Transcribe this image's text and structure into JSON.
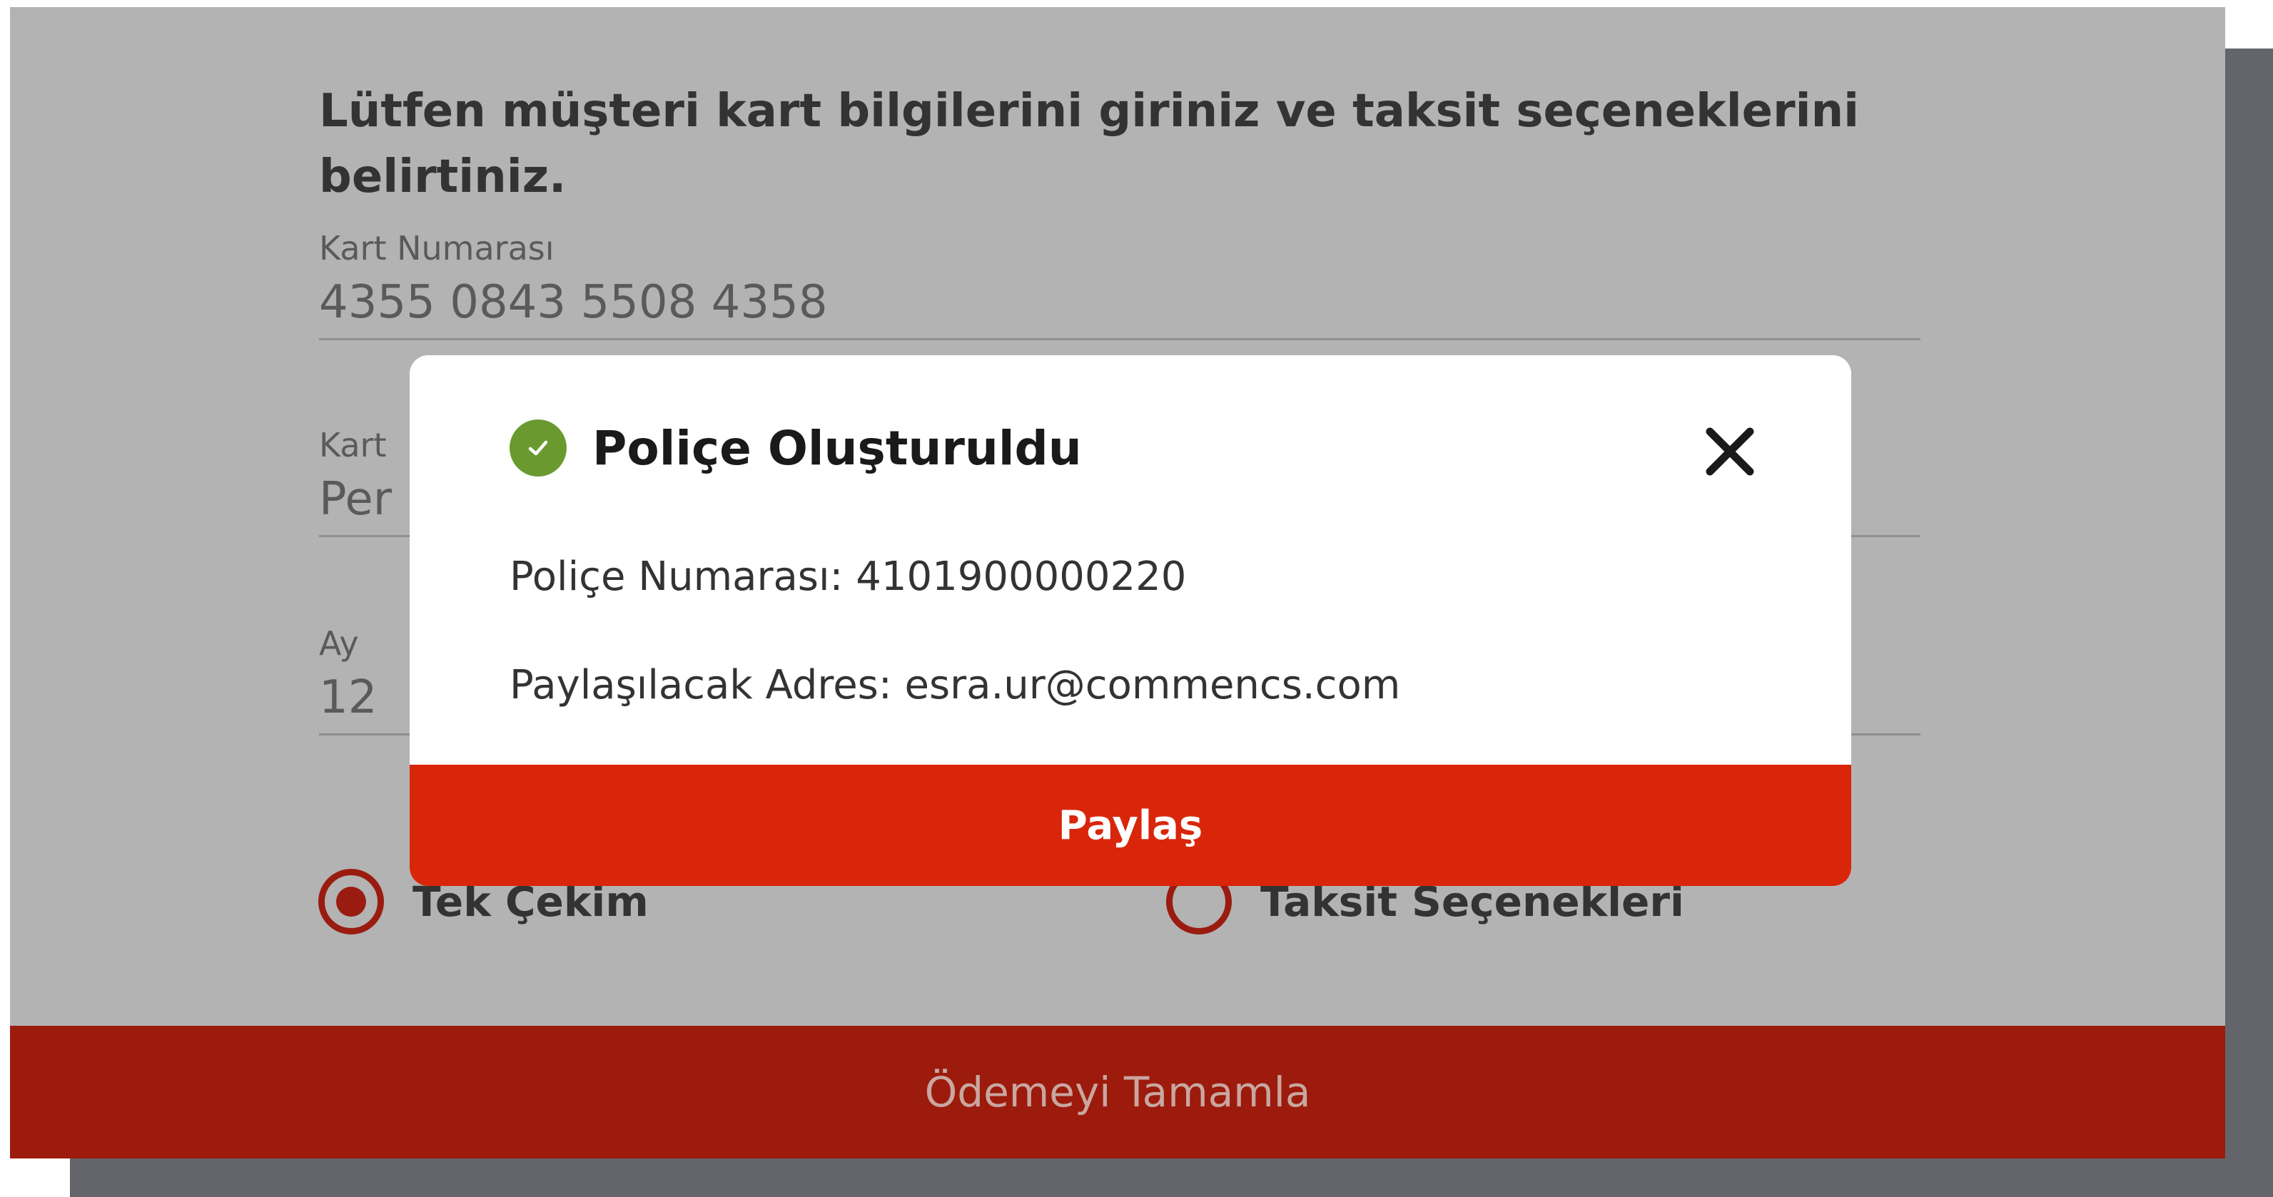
{
  "form": {
    "instruction": "Lütfen müşteri kart bilgilerini giriniz ve taksit seçeneklerini belirtiniz.",
    "card_number_label": "Kart Numarası",
    "card_number_value": "4355 0843 5508 4358",
    "card_holder_label": "Kart",
    "card_holder_value": "Per",
    "month_label": "Ay",
    "month_value": "12"
  },
  "payment_options": [
    {
      "label": "Tek Çekim",
      "selected": true
    },
    {
      "label": "Taksit Seçenekleri",
      "selected": false
    }
  ],
  "complete_button": {
    "label": "Ödemeyi Tamamla"
  },
  "modal": {
    "title": "Poliçe Oluşturuldu",
    "policy_label": "Poliçe Numarası:",
    "policy_number": "4101900000220",
    "address_label": "Paylaşılacak Adres:",
    "address": "esra.ur@commencs.com",
    "share_label": "Paylaş",
    "success_icon": "check-circle-icon",
    "close_icon": "close-icon"
  },
  "colors": {
    "primary_red": "#d9260a",
    "dimmed_red": "#9c1b0c",
    "success_green": "#6a9a2f",
    "overlay_gray": "#b3b3b3"
  }
}
